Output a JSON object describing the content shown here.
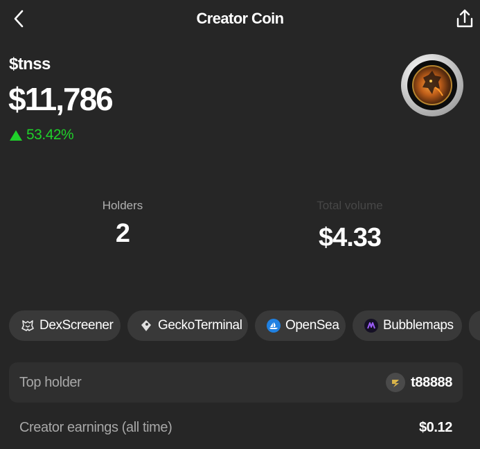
{
  "header": {
    "title": "Creator Coin"
  },
  "coin": {
    "ticker": "$tnss",
    "price": "$11,786",
    "change": "53.42%"
  },
  "stats": {
    "holders_label": "Holders",
    "holders_value": "2",
    "volume_label": "Total volume",
    "volume_value": "$4.33"
  },
  "links": [
    "DexScreener",
    "GeckoTerminal",
    "OpenSea",
    "Bubblemaps"
  ],
  "rows": {
    "top_holder_label": "Top holder",
    "top_holder_value": "t88888",
    "earnings_label": "Creator earnings (all time)",
    "earnings_value": "$0.12"
  },
  "colors": {
    "background": "#262626",
    "positive": "#1fd12a",
    "chip": "#393939",
    "opensea": "#2081e2",
    "bubblemaps": "#7b3fe4"
  },
  "icons": {
    "back": "chevron-left-icon",
    "share": "share-upload-icon",
    "dexscreener": "dexscreener-logo-icon",
    "geckoterminal": "geckoterminal-logo-icon",
    "opensea": "opensea-logo-icon",
    "bubblemaps": "bubblemaps-logo-icon",
    "change": "triangle-up-icon"
  }
}
